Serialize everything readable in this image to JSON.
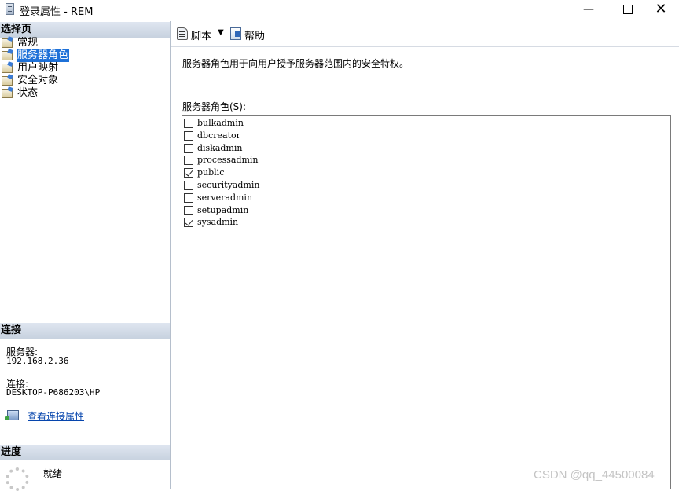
{
  "window": {
    "title": "登录属性 - REM",
    "min_glyph": "—",
    "close_glyph": "✕"
  },
  "left": {
    "pages_header": "选择页",
    "pages": [
      {
        "label": "常规",
        "selected": false
      },
      {
        "label": "服务器角色",
        "selected": true
      },
      {
        "label": "用户映射",
        "selected": false
      },
      {
        "label": "安全对象",
        "selected": false
      },
      {
        "label": "状态",
        "selected": false
      }
    ],
    "connection_header": "连接",
    "server_label": "服务器:",
    "server_value": "192.168.2.36",
    "connection_label": "连接:",
    "connection_value": "DESKTOP-P686203\\HP",
    "view_connection_link": "查看连接属性",
    "progress_header": "进度",
    "progress_status": "就绪"
  },
  "toolbar": {
    "script_label": "脚本",
    "dropdown_glyph": "▼",
    "help_label": "帮助"
  },
  "main": {
    "description": "服务器角色用于向用户授予服务器范围内的安全特权。",
    "roles_label": "服务器角色(S):",
    "roles": [
      {
        "name": "bulkadmin",
        "checked": false
      },
      {
        "name": "dbcreator",
        "checked": false
      },
      {
        "name": "diskadmin",
        "checked": false
      },
      {
        "name": "processadmin",
        "checked": false
      },
      {
        "name": "public",
        "checked": true
      },
      {
        "name": "securityadmin",
        "checked": false
      },
      {
        "name": "serveradmin",
        "checked": false
      },
      {
        "name": "setupadmin",
        "checked": false
      },
      {
        "name": "sysadmin",
        "checked": true
      }
    ]
  },
  "watermark": "CSDN @qq_44500084",
  "colors": {
    "selection": "#1e71d8",
    "link": "#0645ad",
    "header_bg": "#c7d2df"
  }
}
